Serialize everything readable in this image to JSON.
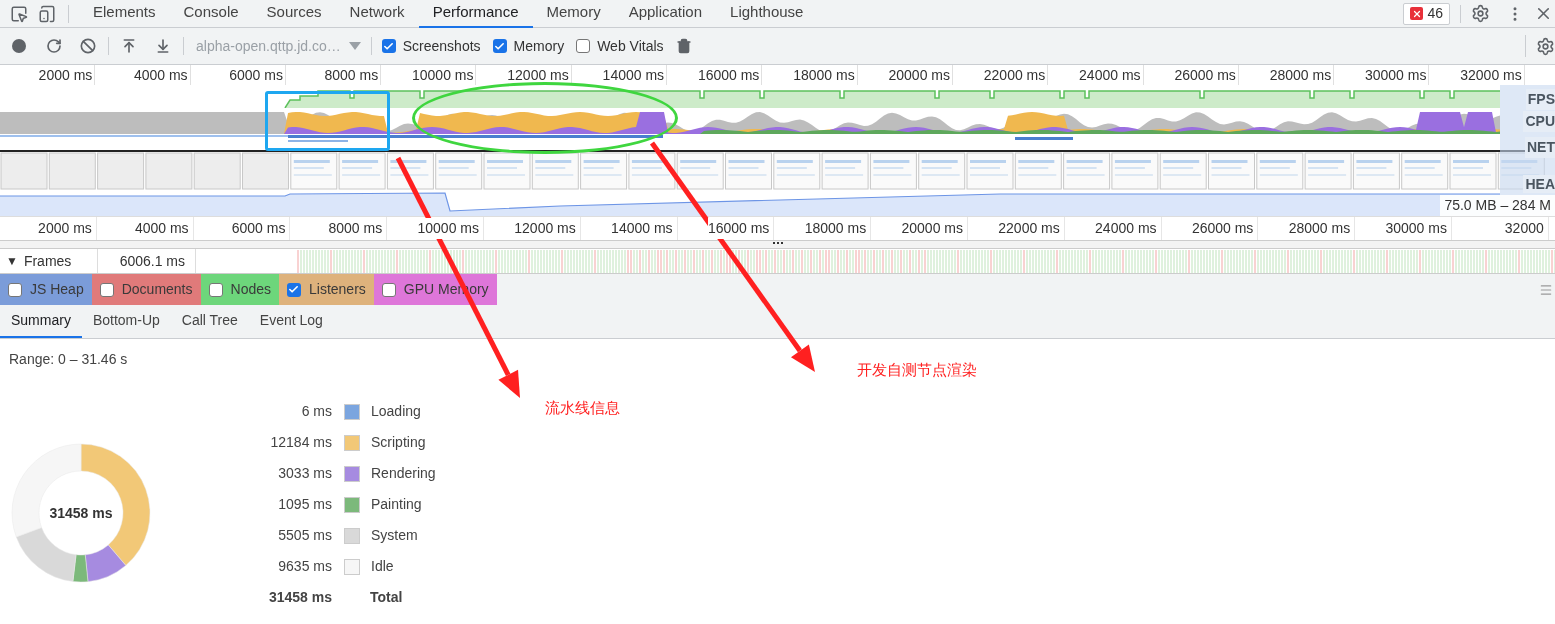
{
  "panel_tabs": [
    {
      "label": "Elements",
      "selected": false
    },
    {
      "label": "Console",
      "selected": false
    },
    {
      "label": "Sources",
      "selected": false
    },
    {
      "label": "Network",
      "selected": false
    },
    {
      "label": "Performance",
      "selected": true
    },
    {
      "label": "Memory",
      "selected": false
    },
    {
      "label": "Application",
      "selected": false
    },
    {
      "label": "Lighthouse",
      "selected": false
    }
  ],
  "error_count": "46",
  "toolbar": {
    "page_select": "alpha-open.qttp.jd.co…",
    "options": [
      {
        "label": "Screenshots",
        "checked": true
      },
      {
        "label": "Memory",
        "checked": true
      },
      {
        "label": "Web Vitals",
        "checked": false
      }
    ]
  },
  "overview": {
    "ruler": [
      "2000 ms",
      "4000 ms",
      "6000 ms",
      "8000 ms",
      "10000 ms",
      "12000 ms",
      "14000 ms",
      "16000 ms",
      "18000 ms",
      "20000 ms",
      "22000 ms",
      "24000 ms",
      "26000 ms",
      "28000 ms",
      "30000 ms",
      "32000 ms"
    ],
    "track_labels": [
      "FPS",
      "CPU",
      "NET",
      "HEA"
    ],
    "heap_range": "75.0 MB – 284 M"
  },
  "main_ruler": [
    "2000 ms",
    "4000 ms",
    "6000 ms",
    "8000 ms",
    "10000 ms",
    "12000 ms",
    "14000 ms",
    "16000 ms",
    "18000 ms",
    "20000 ms",
    "22000 ms",
    "24000 ms",
    "26000 ms",
    "28000 ms",
    "30000 ms",
    "32000"
  ],
  "frames": {
    "toggle": "▼",
    "label": "Frames",
    "duration": "6006.1 ms"
  },
  "counters": [
    {
      "label": "JS Heap",
      "checked": false,
      "color": "#7b9cd9"
    },
    {
      "label": "Documents",
      "checked": false,
      "color": "#e07a7a"
    },
    {
      "label": "Nodes",
      "checked": false,
      "color": "#6dd67b"
    },
    {
      "label": "Listeners",
      "checked": true,
      "color": "#deb27c"
    },
    {
      "label": "GPU Memory",
      "checked": false,
      "color": "#de76d9"
    }
  ],
  "detail_tabs": [
    {
      "label": "Summary",
      "selected": true
    },
    {
      "label": "Bottom-Up",
      "selected": false
    },
    {
      "label": "Call Tree",
      "selected": false
    },
    {
      "label": "Event Log",
      "selected": false
    }
  ],
  "summary": {
    "range": "Range: 0 – 31.46 s",
    "center_label": "31458 ms",
    "items": [
      {
        "value": "6 ms",
        "label": "Loading",
        "color": "#7ba5df"
      },
      {
        "value": "12184 ms",
        "label": "Scripting",
        "color": "#f2c877"
      },
      {
        "value": "3033 ms",
        "label": "Rendering",
        "color": "#a68be0"
      },
      {
        "value": "1095 ms",
        "label": "Painting",
        "color": "#7cb97b"
      },
      {
        "value": "5505 ms",
        "label": "System",
        "color": "#d9d9d9"
      },
      {
        "value": "9635 ms",
        "label": "Idle",
        "color": "#f6f6f6"
      }
    ],
    "total": {
      "value": "31458 ms",
      "label": "Total"
    }
  },
  "annotations": [
    {
      "kind": "rectangle",
      "color": "#1ea7f0"
    },
    {
      "kind": "ellipse",
      "color": "#3fd63f"
    },
    {
      "kind": "arrow",
      "color": "#ff2020",
      "text": "流水线信息"
    },
    {
      "kind": "arrow",
      "color": "#ff2020",
      "text": "开发自测节点渲染"
    }
  ]
}
